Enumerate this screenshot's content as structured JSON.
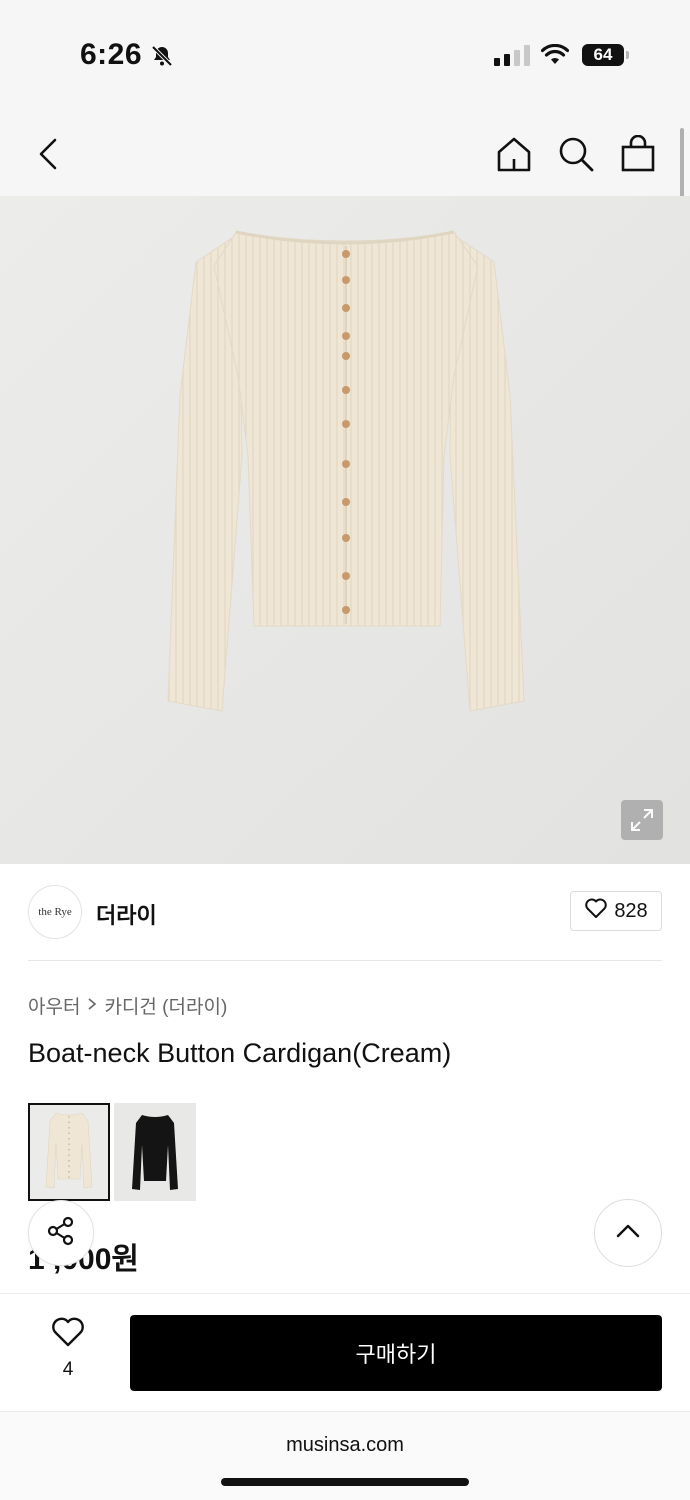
{
  "status": {
    "time": "6:26",
    "battery": "64"
  },
  "nav": {
    "back_icon": "chevron-left-icon",
    "home_icon": "home-icon",
    "search_icon": "search-icon",
    "bag_icon": "shopping-bag-icon"
  },
  "brand": {
    "logo_text": "the Rye",
    "name": "더라이",
    "likes": "828"
  },
  "product": {
    "breadcrumb": [
      "아우터",
      "카디건 (더라이)"
    ],
    "title": "Boat-neck Button Cardigan(Cream)",
    "price": "1 ,000원",
    "variants": [
      {
        "name": "cream",
        "color": "#efe7d9",
        "selected": true
      },
      {
        "name": "black",
        "color": "#141414",
        "selected": false
      }
    ]
  },
  "actions": {
    "wish_count": "4",
    "buy_label": "구매하기"
  },
  "browser": {
    "url": "musinsa.com"
  },
  "colors": {
    "garment": "#efe6d6",
    "button": "#c8996a",
    "background": "#e8e8e6"
  }
}
